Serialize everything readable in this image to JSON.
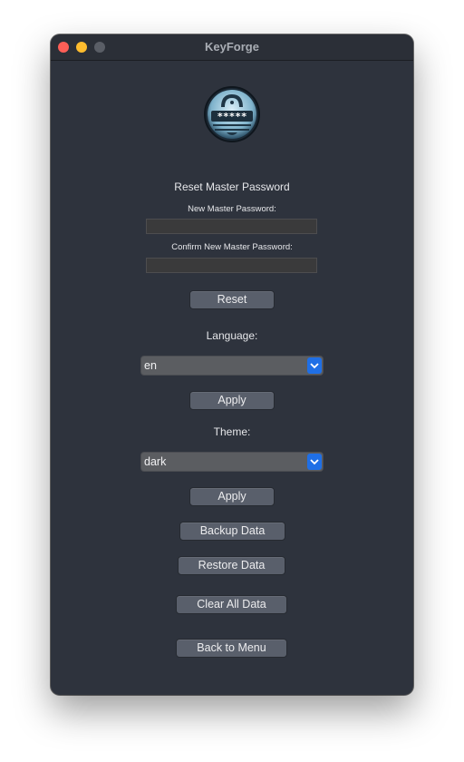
{
  "window": {
    "title": "KeyForge"
  },
  "reset_section": {
    "heading": "Reset Master Password",
    "new_password_label": "New Master Password:",
    "new_password_value": "",
    "confirm_password_label": "Confirm New Master Password:",
    "confirm_password_value": "",
    "reset_label": "Reset"
  },
  "language_section": {
    "label": "Language:",
    "selected": "en",
    "apply_label": "Apply"
  },
  "theme_section": {
    "label": "Theme:",
    "selected": "dark",
    "apply_label": "Apply"
  },
  "actions": {
    "backup_label": "Backup Data",
    "restore_label": "Restore Data",
    "clear_label": "Clear All Data",
    "back_label": "Back to Menu"
  },
  "logo": {
    "masked_text": "*****",
    "icon": "lock-password-logo-icon"
  },
  "colors": {
    "window_background": "#2e333d",
    "button": "#595f6b",
    "select_accent": "#1f6fe6",
    "close": "#ff5f57",
    "minimize": "#febc2e"
  }
}
